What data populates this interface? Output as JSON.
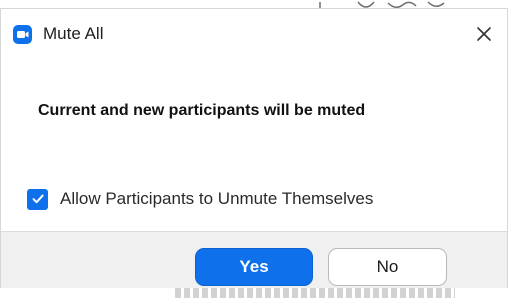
{
  "dialog": {
    "title": "Mute All",
    "app_icon": "zoom-camera-icon",
    "close_icon": "close-icon",
    "message": "Current and new participants will be muted",
    "checkbox": {
      "label": "Allow Participants to Unmute Themselves",
      "checked": true
    },
    "buttons": {
      "yes_label": "Yes",
      "no_label": "No"
    }
  },
  "colors": {
    "accent": "#0e71eb",
    "footer_bg": "#f0f0f0",
    "text": "#202020"
  }
}
